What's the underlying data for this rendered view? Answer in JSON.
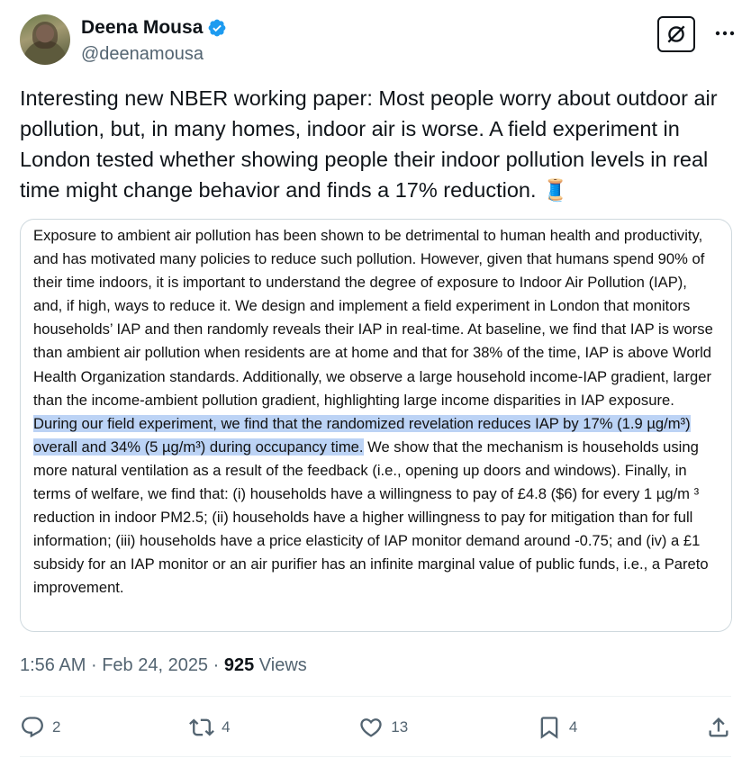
{
  "author": {
    "display_name": "Deena Mousa",
    "handle": "@deenamousa",
    "verified": true
  },
  "tweet": {
    "text": "Interesting new NBER working paper: Most people worry about outdoor air pollution, but, in many homes, indoor air is worse. A field experiment in London tested whether showing people their indoor pollution levels in real time might change behavior and finds a 17% reduction. 🧵"
  },
  "abstract": {
    "before": "Exposure to ambient air pollution has been shown to be detrimental to human health and productivity, and has motivated many policies to reduce such pollution. However, given that humans spend 90% of their time indoors, it is important to understand the degree of exposure to Indoor Air Pollution (IAP), and, if high, ways to reduce it. We design and implement a field experiment in London that monitors households’ IAP and then randomly reveals their IAP in real-time. At baseline, we find that IAP is worse than ambient air pollution when residents are at home and that for 38% of the time, IAP is above World Health Organization standards. Additionally, we observe a large household income-IAP gradient, larger than the income-ambient pollution gradient, highlighting large income disparities in IAP exposure. ",
    "highlight": "During our field experiment, we find that the randomized revelation reduces IAP by 17% (1.9 µg/m³) overall and 34% (5 µg/m³) during occupancy time.",
    "after": " We show that the mechanism is households using more natural ventilation as a result of the feedback (i.e., opening up doors and windows). Finally, in terms of welfare, we find that: (i) households have a willingness to pay of £4.8 ($6) for every 1 µg/m ³ reduction in indoor PM2.5; (ii) households have a higher willingness to pay for mitigation than for full information; (iii) households have a price elasticity of IAP monitor demand around -0.75; and (iv) a £1 subsidy for an IAP monitor or an air purifier has an infinite marginal value of public funds, i.e., a Pareto improvement."
  },
  "meta": {
    "time": "1:56 AM",
    "separator": "·",
    "date": "Feb 24, 2025",
    "views_count": "925",
    "views_label": "Views"
  },
  "actions": {
    "replies": "2",
    "reposts": "4",
    "likes": "13",
    "bookmarks": "4"
  },
  "colors": {
    "text": "#0f1419",
    "secondary": "#536471",
    "verified": "#1d9bf0",
    "highlight": "#bcd3f5"
  }
}
